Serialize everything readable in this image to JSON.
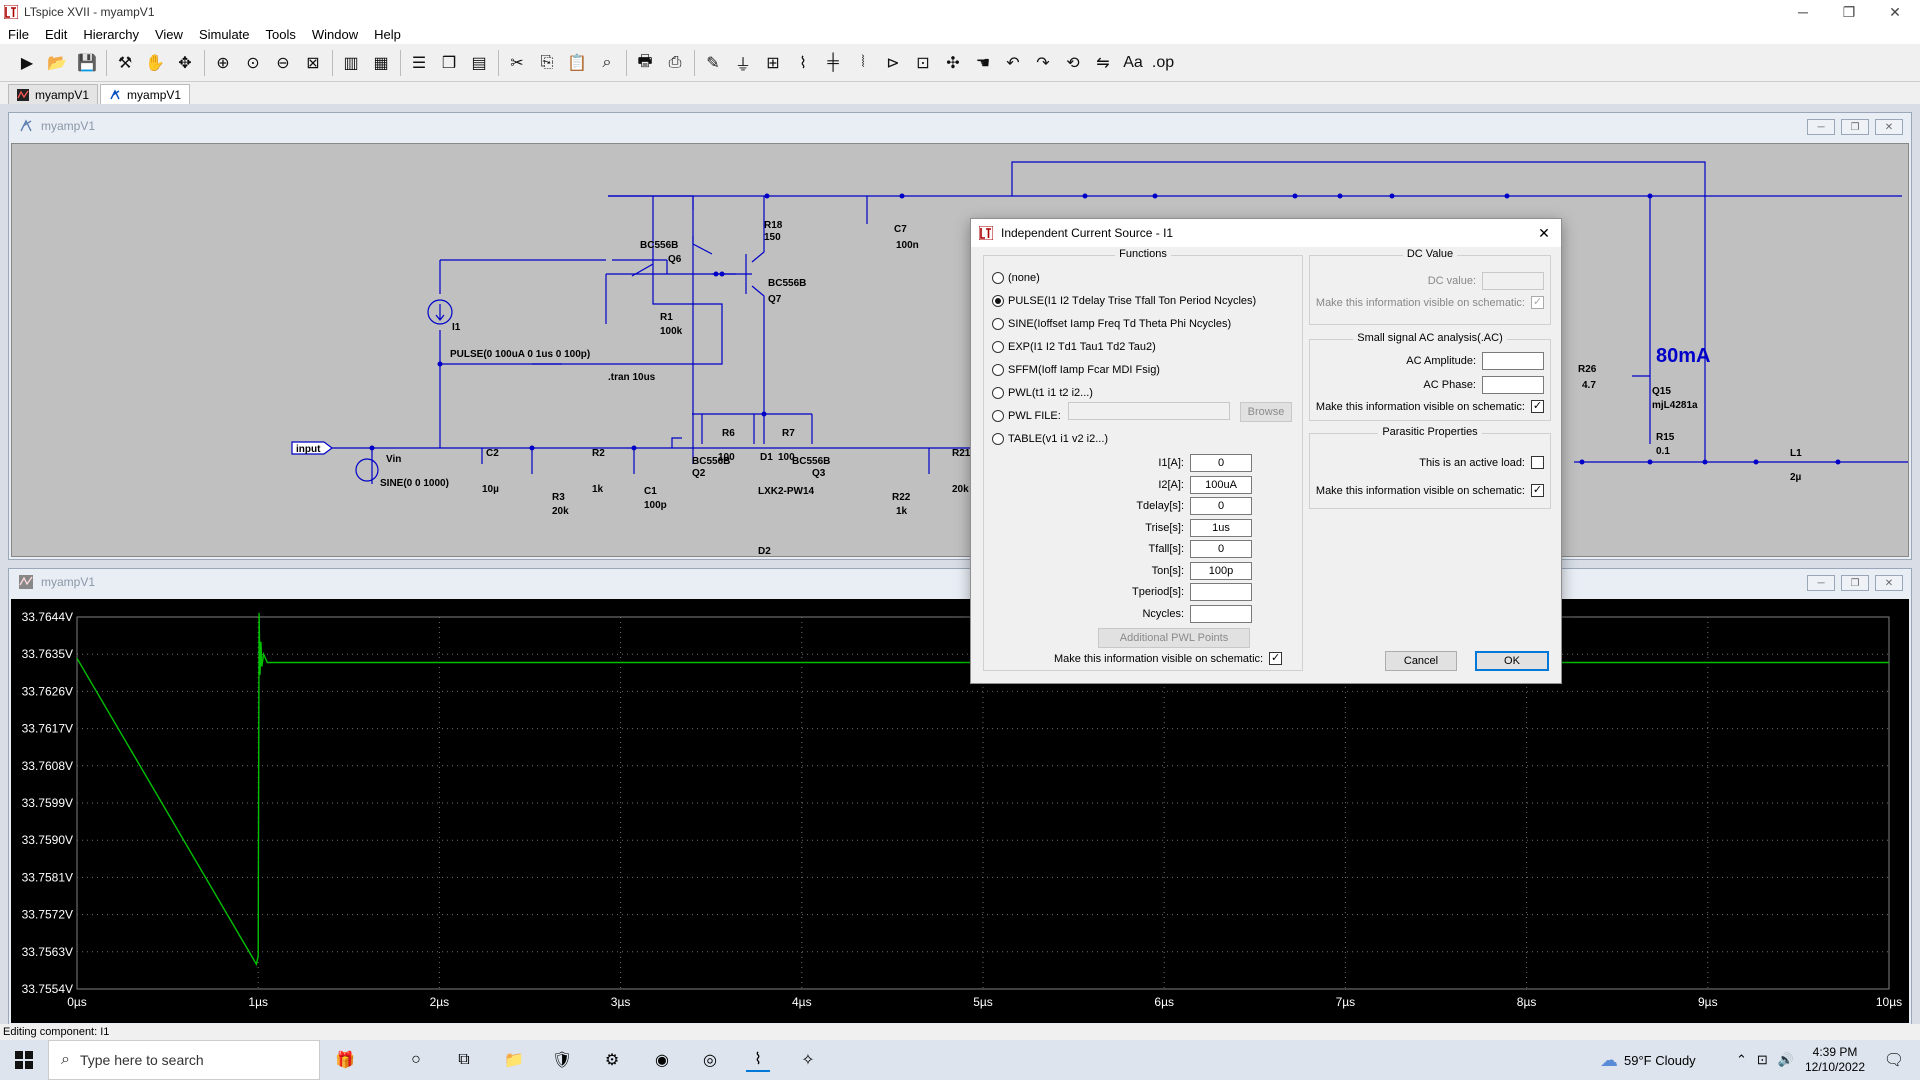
{
  "window": {
    "title": "LTspice XVII - myampV1",
    "minimize": "─",
    "restore": "❐",
    "close": "✕"
  },
  "menu": [
    "File",
    "Edit",
    "Hierarchy",
    "View",
    "Simulate",
    "Tools",
    "Window",
    "Help"
  ],
  "toolbar_icons": [
    "run-icon",
    "open-icon",
    "save-icon",
    "control-panel-icon",
    "halt-icon",
    "pan-icon",
    "zoom-in-icon",
    "zoom-area-icon",
    "zoom-out-icon",
    "zoom-fit-icon",
    "plot-settings-icon",
    "autorange-icon",
    "tile-horizontal-icon",
    "cascade-icon",
    "tile-vertical-icon",
    "cut-icon",
    "copy-icon",
    "paste-icon",
    "find-icon",
    "print-icon",
    "print-preview-icon",
    "wire-icon",
    "ground-icon",
    "label-icon",
    "resistor-icon",
    "capacitor-icon",
    "inductor-icon",
    "diode-icon",
    "component-icon",
    "move-icon",
    "drag-icon",
    "undo-icon",
    "redo-icon",
    "rotate-icon",
    "mirror-icon",
    "text-icon",
    "spice-directive-icon"
  ],
  "doc_tabs": [
    {
      "label": "myampV1",
      "active": false
    },
    {
      "label": "myampV1",
      "active": true
    }
  ],
  "schematic": {
    "title": "myampV1",
    "labels": {
      "r18": "R18",
      "r18v": "150",
      "c7": "C7",
      "c7v": "100n",
      "q6": "BC556B",
      "q6n": "Q6",
      "q7": "BC556B",
      "q7n": "Q7",
      "i1": "I1",
      "i1v": "PULSE(0 100uA 0 1us 0 100p)",
      "r1": "R1",
      "r1v": "100k",
      "tran": ".tran 10us",
      "r6": "R6",
      "r6v": "100",
      "r7": "R7",
      "r7v": "100",
      "input": "input",
      "vin": "Vin",
      "vinv": "SINE(0 0 1000)",
      "c2": "C2",
      "c2v": "10µ",
      "r2": "R2",
      "r2v": "1k",
      "r3": "R3",
      "r3v": "20k",
      "c1": "C1",
      "c1v": "100p",
      "q2": "BC556B",
      "q2n": "Q2",
      "d1": "D1",
      "d1v": "LXK2-PW14",
      "q3": "BC556B",
      "q3n": "Q3",
      "d2": "D2",
      "r22": "R22",
      "r22v": "1k",
      "r21": "R21",
      "r21v": "20k",
      "r26": "R26",
      "r26v": "4.7",
      "q15": "Q15",
      "q15v": "mjL4281a",
      "current": "80mA",
      "r15": "R15",
      "r15v": "0.1",
      "l1": "L1",
      "l1v": "2µ"
    }
  },
  "waveform": {
    "title": "myampV1",
    "trace_label": "V",
    "trace_color": "#00c000"
  },
  "chart_data": {
    "type": "line",
    "title": "",
    "xlabel": "",
    "ylabel": "",
    "x_ticks": [
      "0µs",
      "1µs",
      "2µs",
      "3µs",
      "4µs",
      "5µs",
      "6µs",
      "7µs",
      "8µs",
      "9µs",
      "10µs"
    ],
    "y_ticks": [
      "33.7644V",
      "33.7635V",
      "33.7626V",
      "33.7617V",
      "33.7608V",
      "33.7599V",
      "33.7590V",
      "33.7581V",
      "33.7572V",
      "33.7563V",
      "33.7554V"
    ],
    "xlim": [
      0,
      10
    ],
    "ylim": [
      33.7554,
      33.7644
    ],
    "grid": true,
    "series": [
      {
        "x": [
          0,
          0.99,
          1.0,
          1.005,
          1.01,
          1.015,
          1.02,
          1.03,
          1.05,
          1.2,
          10
        ],
        "y": [
          33.7634,
          33.756,
          33.7562,
          33.7645,
          33.763,
          33.7638,
          33.7632,
          33.7635,
          33.7633,
          33.7633,
          33.7633
        ]
      }
    ]
  },
  "dialog": {
    "title": "Independent Current Source - I1",
    "close": "✕",
    "functions_title": "Functions",
    "functions": [
      {
        "label": "(none)",
        "selected": false
      },
      {
        "label": "PULSE(I1 I2 Tdelay Trise Tfall Ton Period Ncycles)",
        "selected": true
      },
      {
        "label": "SINE(Ioffset Iamp Freq Td Theta Phi Ncycles)",
        "selected": false
      },
      {
        "label": "EXP(I1 I2 Td1 Tau1 Td2 Tau2)",
        "selected": false
      },
      {
        "label": "SFFM(Ioff Iamp Fcar MDI Fsig)",
        "selected": false
      },
      {
        "label": "PWL(t1 i1 t2 i2...)",
        "selected": false
      },
      {
        "label": "PWL FILE:",
        "selected": false
      },
      {
        "label": "TABLE(v1 i1 v2 i2...)",
        "selected": false
      }
    ],
    "browse_label": "Browse",
    "params": [
      {
        "label": "I1[A]:",
        "value": "0"
      },
      {
        "label": "I2[A]:",
        "value": "100uA"
      },
      {
        "label": "Tdelay[s]:",
        "value": "0"
      },
      {
        "label": "Trise[s]:",
        "value": "1us"
      },
      {
        "label": "Tfall[s]:",
        "value": "0"
      },
      {
        "label": "Ton[s]:",
        "value": "100p"
      },
      {
        "label": "Tperiod[s]:",
        "value": ""
      },
      {
        "label": "Ncycles:",
        "value": ""
      }
    ],
    "additional_pwl": "Additional PWL Points",
    "visible_functions": "Make this information visible on schematic:",
    "dc_title": "DC Value",
    "dc_label": "DC value:",
    "dc_value": "",
    "dc_visible": "Make this information visible on schematic:",
    "ac_title": "Small signal AC analysis(.AC)",
    "ac_amp_label": "AC Amplitude:",
    "ac_amp_value": "",
    "ac_phase_label": "AC Phase:",
    "ac_phase_value": "",
    "ac_visible": "Make this information visible on schematic:",
    "parasitic_title": "Parasitic Properties",
    "active_load": "This is an active load:",
    "parasitic_visible": "Make this information visible on schematic:",
    "cancel": "Cancel",
    "ok": "OK",
    "check_mark": "✓"
  },
  "status": "Editing component: I1",
  "taskbar": {
    "search_placeholder": "Type here to search",
    "weather": "59°F  Cloudy",
    "time": "4:39 PM",
    "date": "12/10/2022"
  }
}
